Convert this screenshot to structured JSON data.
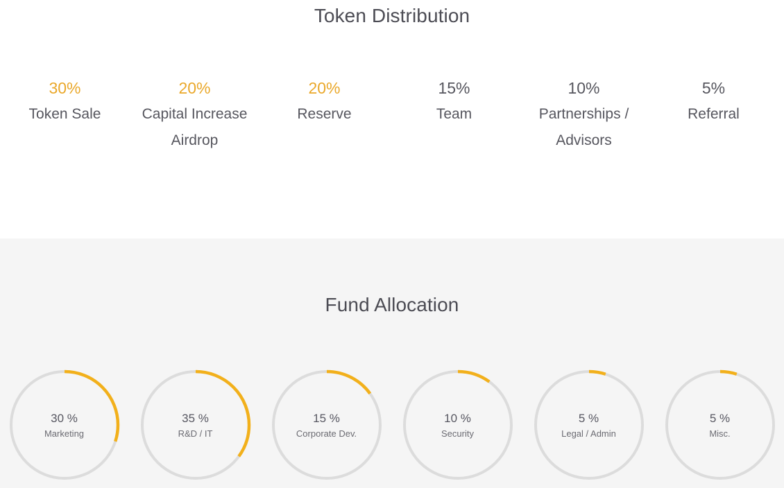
{
  "token_distribution": {
    "title": "Token Distribution",
    "items": [
      {
        "percent": "30%",
        "label": "Token Sale",
        "accent": true
      },
      {
        "percent": "20%",
        "label": "Capital Increase Airdrop",
        "accent": true
      },
      {
        "percent": "20%",
        "label": "Reserve",
        "accent": true
      },
      {
        "percent": "15%",
        "label": "Team",
        "accent": false
      },
      {
        "percent": "10%",
        "label": "Partnerships / Advisors",
        "accent": false
      },
      {
        "percent": "5%",
        "label": "Referral",
        "accent": false
      }
    ]
  },
  "fund_allocation": {
    "title": "Fund Allocation",
    "items": [
      {
        "percent": "30 %",
        "label": "Marketing",
        "value": 30
      },
      {
        "percent": "35 %",
        "label": "R&D / IT",
        "value": 35
      },
      {
        "percent": "15 %",
        "label": "Corporate Dev.",
        "value": 15
      },
      {
        "percent": "10 %",
        "label": "Security",
        "value": 10
      },
      {
        "percent": "5 %",
        "label": "Legal / Admin",
        "value": 5
      },
      {
        "percent": "5 %",
        "label": "Misc.",
        "value": 5
      }
    ]
  },
  "colors": {
    "accent_text": "#eaa82a",
    "arc": "#f2b01b",
    "track": "#dcdcdc",
    "heading": "#4c4c54",
    "body_text": "#56565e",
    "section_bg": "#f5f5f5",
    "page_bg": "#ffffff"
  },
  "chart_data": [
    {
      "type": "bar",
      "title": "Token Distribution",
      "categories": [
        "Token Sale",
        "Capital Increase Airdrop",
        "Reserve",
        "Team",
        "Partnerships / Advisors",
        "Referral"
      ],
      "values": [
        30,
        20,
        20,
        15,
        10,
        5
      ],
      "xlabel": "",
      "ylabel": "",
      "ylim": [
        0,
        100
      ],
      "grid": false,
      "legend": "none",
      "annotations": [
        "30%",
        "20%",
        "20%",
        "15%",
        "10%",
        "5%"
      ]
    },
    {
      "type": "pie",
      "title": "Fund Allocation",
      "categories": [
        "Marketing",
        "R&D / IT",
        "Corporate Dev.",
        "Security",
        "Legal / Admin",
        "Misc."
      ],
      "values": [
        30,
        35,
        15,
        10,
        5,
        5
      ],
      "xlabel": "",
      "ylabel": "",
      "grid": false,
      "legend": "none",
      "annotations": [
        "30 %",
        "35 %",
        "15 %",
        "10 %",
        "5 %",
        "5 %"
      ]
    }
  ]
}
